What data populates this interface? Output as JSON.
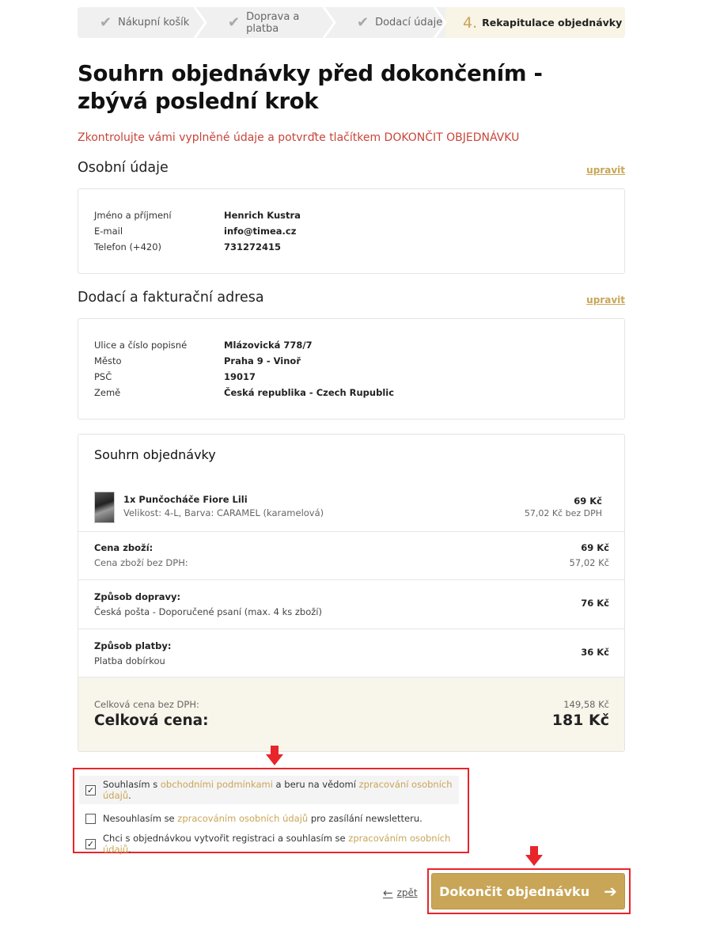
{
  "steps": [
    {
      "label": "Nákupní košík",
      "done": true
    },
    {
      "label": "Doprava a platba",
      "done": true
    },
    {
      "label": "Dodací údaje",
      "done": true
    },
    {
      "number": "4.",
      "label": "Rekapitulace objednávky",
      "active": true
    }
  ],
  "page": {
    "title": "Souhrn objednávky před dokončením - zbývá poslední krok",
    "warning": "Zkontrolujte vámi vyplněné údaje a potvrďte tlačítkem DOKONČIT OBJEDNÁVKU"
  },
  "personal": {
    "title": "Osobní údaje",
    "edit": "upravit",
    "rows": [
      {
        "k": "Jméno a příjmení",
        "v": "Henrich Kustra"
      },
      {
        "k": "E-mail",
        "v": "info@timea.cz"
      },
      {
        "k": "Telefon (+420)",
        "v": "731272415"
      }
    ]
  },
  "address": {
    "title": "Dodací a fakturační adresa",
    "edit": "upravit",
    "rows": [
      {
        "k": "Ulice a číslo popisné",
        "v": "Mlázovická 778/7"
      },
      {
        "k": "Město",
        "v": "Praha 9 - Vinoř"
      },
      {
        "k": "PSČ",
        "v": "19017"
      },
      {
        "k": "Země",
        "v": "Česká republika - Czech Rupublic"
      }
    ]
  },
  "summary": {
    "title": "Souhrn objednávky",
    "product": {
      "name": "1x Punčocháče Fiore Lili",
      "variant": "Velikost: 4-L, Barva: CARAMEL (karamelová)",
      "price": "69 Kč",
      "net": "57,02 Kč bez DPH"
    },
    "goods": {
      "label": "Cena zboží:",
      "net_label": "Cena zboží bez DPH:",
      "price": "69 Kč",
      "net": "57,02 Kč"
    },
    "shipping": {
      "label": "Způsob dopravy:",
      "value": "Česká pošta - Doporučené psaní (max. 4 ks zboží)",
      "price": "76 Kč"
    },
    "payment": {
      "label": "Způsob platby:",
      "value": "Platba dobírkou",
      "price": "36 Kč"
    },
    "total": {
      "net_label": "Celková cena bez DPH:",
      "net": "149,58 Kč",
      "label": "Celková cena:",
      "value": "181 Kč"
    }
  },
  "consents": [
    {
      "checked": true,
      "pre": "Souhlasím s ",
      "link1": "obchodními podmínkami",
      "mid": " a beru na vědomí ",
      "link2": "zpracování osobních údajů",
      "post": "."
    },
    {
      "checked": false,
      "pre": "Nesouhlasím se ",
      "link1": "zpracováním osobních údajů",
      "post": " pro zasílání newsletteru."
    },
    {
      "checked": true,
      "pre": "Chci s objednávkou vytvořit registraci a souhlasím se ",
      "link1": "zpracováním osobních údajů",
      "post": "."
    }
  ],
  "actions": {
    "back": "zpět",
    "finish": "Dokončit objednávku"
  },
  "colors": {
    "accent": "#c9a557",
    "warning": "#c8453a",
    "annotation": "#e8252b"
  }
}
